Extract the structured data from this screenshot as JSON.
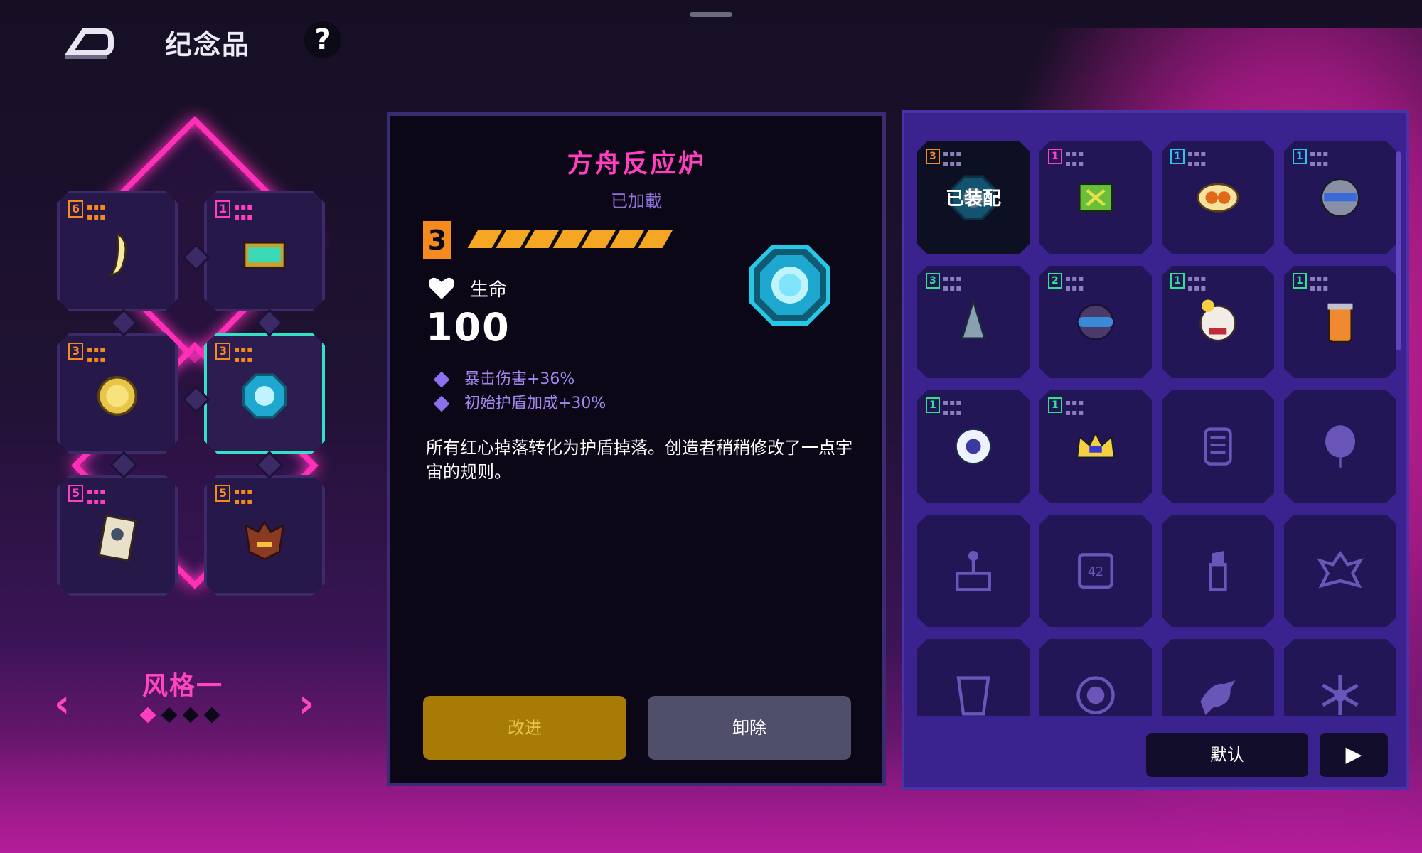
{
  "header": {
    "title": "纪念品",
    "help_label": "?"
  },
  "loadout": {
    "slots": [
      {
        "rank": "6",
        "rank_color": "#f58a1f",
        "icon": "fang-icon",
        "selected": false
      },
      {
        "rank": "1",
        "rank_color": "#ff3fbf",
        "icon": "treasure-chest-icon",
        "selected": false
      },
      {
        "rank": "3",
        "rank_color": "#f58a1f",
        "icon": "gold-coin-icon",
        "selected": false
      },
      {
        "rank": "3",
        "rank_color": "#f58a1f",
        "icon": "cyan-gem-icon",
        "selected": true
      },
      {
        "rank": "5",
        "rank_color": "#ff3fbf",
        "icon": "portrait-card-icon",
        "selected": false
      },
      {
        "rank": "5",
        "rank_color": "#f58a1f",
        "icon": "demon-mask-icon",
        "selected": false
      }
    ],
    "style_name": "风格一",
    "prev_arrow": "‹",
    "next_arrow": "›",
    "pages": 4,
    "active_page": 0
  },
  "detail": {
    "title": "方舟反应炉",
    "status": "已加載",
    "rank": "3",
    "stars": 7,
    "stat_label": "生命",
    "stat_value": "100",
    "attributes": [
      "暴击伤害+36%",
      "初始护盾加成+30%"
    ],
    "description": "所有红心掉落转化为护盾掉落。创造者稍稍修改了一点宇宙的规则。",
    "upgrade_label": "改进",
    "unequip_label": "卸除",
    "colors": {
      "title": "#ff3fbf",
      "rank": "#f58a1f",
      "gem": "#27c7e8"
    }
  },
  "inventory": {
    "items": [
      {
        "rank": "3",
        "rank_color": "#f58a1f",
        "icon": "cyan-gem-icon",
        "equipped_label": "已装配",
        "selected": true,
        "locked": false
      },
      {
        "rank": "1",
        "rank_color": "#ff3fbf",
        "icon": "green-cube-icon",
        "selected": false,
        "locked": false
      },
      {
        "rank": "1",
        "rank_color": "#27c7e8",
        "icon": "peanut-icon",
        "selected": false,
        "locked": false
      },
      {
        "rank": "1",
        "rank_color": "#27c7e8",
        "icon": "robot-helmet-icon",
        "selected": false,
        "locked": false
      },
      {
        "rank": "3",
        "rank_color": "#2ee38e",
        "icon": "drill-bit-icon",
        "selected": false,
        "locked": false
      },
      {
        "rank": "2",
        "rank_color": "#2ee38e",
        "icon": "visor-goggles-icon",
        "selected": false,
        "locked": false
      },
      {
        "rank": "1",
        "rank_color": "#2ee38e",
        "icon": "clown-face-icon",
        "selected": false,
        "locked": false
      },
      {
        "rank": "1",
        "rank_color": "#2ee38e",
        "icon": "jar-icon",
        "selected": false,
        "locked": false
      },
      {
        "rank": "1",
        "rank_color": "#2ee38e",
        "icon": "eyeball-icon",
        "selected": false,
        "locked": false
      },
      {
        "rank": "1",
        "rank_color": "#2ee38e",
        "icon": "crown-icon",
        "selected": false,
        "locked": false
      },
      {
        "rank": "",
        "icon": "ribcage-icon",
        "selected": false,
        "locked": true
      },
      {
        "rank": "",
        "icon": "balloon-icon",
        "selected": false,
        "locked": true
      },
      {
        "rank": "",
        "icon": "joystick-icon",
        "selected": false,
        "locked": true
      },
      {
        "rank": "",
        "icon": "chip-42-icon",
        "selected": false,
        "locked": true
      },
      {
        "rank": "",
        "icon": "lipstick-icon",
        "selected": false,
        "locked": true
      },
      {
        "rank": "",
        "icon": "winged-emblem-icon",
        "selected": false,
        "locked": true
      },
      {
        "rank": "",
        "icon": "cup-icon",
        "selected": false,
        "locked": true
      },
      {
        "rank": "",
        "icon": "skull-coin-icon",
        "selected": false,
        "locked": true
      },
      {
        "rank": "",
        "icon": "bird-icon",
        "selected": false,
        "locked": true
      },
      {
        "rank": "",
        "icon": "snowflake-icon",
        "selected": false,
        "locked": true
      }
    ],
    "default_label": "默认",
    "next_label": "▶"
  }
}
